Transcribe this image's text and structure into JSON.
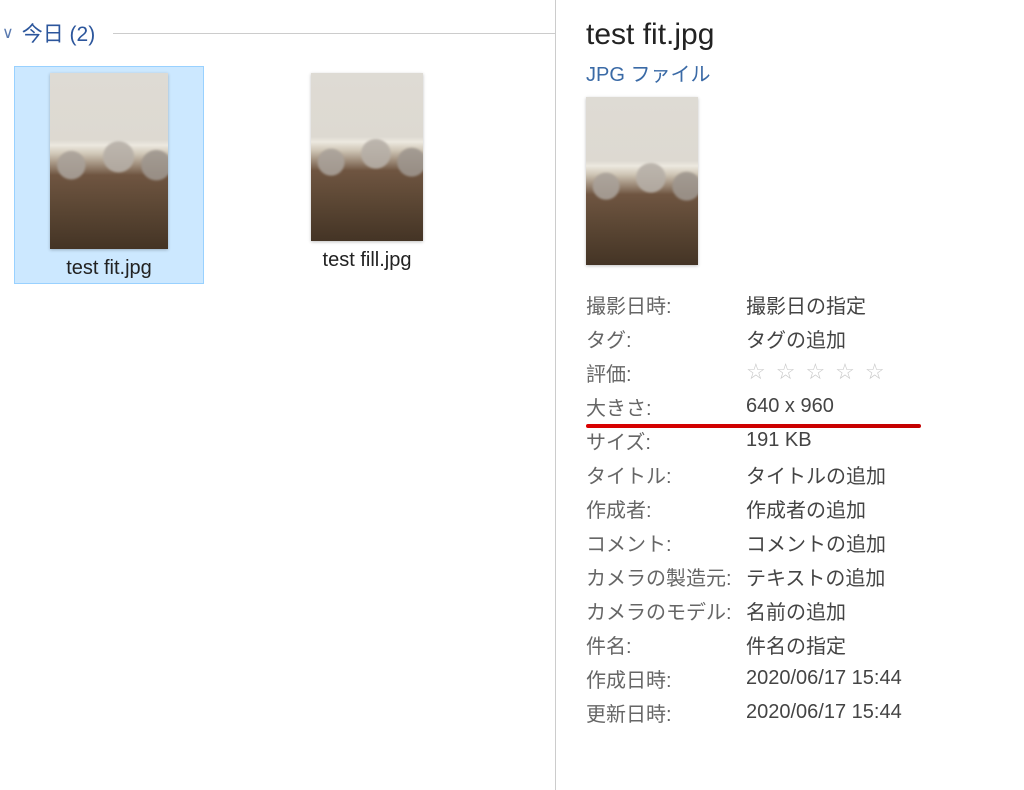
{
  "group": {
    "chevron": "∨",
    "label": "今日 (2)"
  },
  "files": [
    {
      "name": "test fit.jpg",
      "selected": true
    },
    {
      "name": "test fill.jpg",
      "selected": false
    }
  ],
  "details": {
    "filename": "test fit.jpg",
    "filetype": "JPG ファイル",
    "props": {
      "shoot_label": "撮影日時:",
      "shoot_val": "撮影日の指定",
      "tag_label": "タグ:",
      "tag_val": "タグの追加",
      "rating_label": "評価:",
      "rating_val": "☆☆☆☆☆",
      "dim_label": "大きさ:",
      "dim_val": "640 x 960",
      "size_label": "サイズ:",
      "size_val": "191 KB",
      "title_label": "タイトル:",
      "title_val": "タイトルの追加",
      "author_label": "作成者:",
      "author_val": "作成者の追加",
      "comment_label": "コメント:",
      "comment_val": "コメントの追加",
      "maker_label": "カメラの製造元:",
      "maker_val": "テキストの追加",
      "model_label": "カメラのモデル:",
      "model_val": "名前の追加",
      "subject_label": "件名:",
      "subject_val": "件名の指定",
      "created_label": "作成日時:",
      "created_val": "2020/06/17 15:44",
      "modified_label": "更新日時:",
      "modified_val": "2020/06/17 15:44"
    }
  }
}
